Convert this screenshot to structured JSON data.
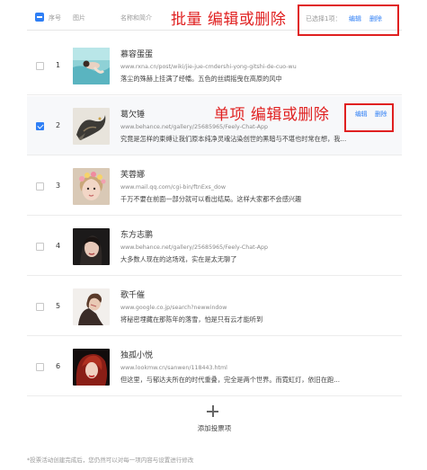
{
  "header": {
    "col_index": "序号",
    "col_image": "图片",
    "col_name": "名称和简介",
    "batch_annotation": "批量 编辑或删除",
    "selected_text": "已选择1项：",
    "edit_label": "编辑",
    "delete_label": "删除"
  },
  "row_annotation": "单项 编辑或删除",
  "row_actions": {
    "edit_label": "编辑",
    "delete_label": "删除"
  },
  "rows": [
    {
      "index": "1",
      "title": "慕容蛋蛋",
      "url": "www.rxna.cn/post/wiki/jie-jue-cmdershi-yong-gitshi-de-cuo-wu",
      "desc": "落尘的殊赫上挂满了经幡。五色的丝绸摇曳在高原的风中",
      "checked": false,
      "image": "pool-photo"
    },
    {
      "index": "2",
      "title": "葛欠锤",
      "url": "www.behance.net/gallery/25685965/Feely-Chat-App",
      "desc": "究竟是怎样的柬缚让我们原本纯净灵魂沾染创世的黑暗与不堪也时常在想，我...",
      "checked": true,
      "image": "dragon-photo"
    },
    {
      "index": "3",
      "title": "芙蓉娜",
      "url": "www.mail.qq.com/cgi-bin/ftnExs_dow",
      "desc": "千万不要在前面一部分就可以看出结局。这样大家都不会感兴趣",
      "checked": false,
      "image": "flower-crown-portrait"
    },
    {
      "index": "4",
      "title": "东方志鹏",
      "url": "www.behance.net/gallery/25685965/Feely-Chat-App",
      "desc": "大多数人现在的这场戏，实在是太无聊了",
      "checked": false,
      "image": "dark-portrait"
    },
    {
      "index": "5",
      "title": "歌千催",
      "url": "www.google.co.jp/search?newwindow",
      "desc": "将秘密埋藏在那陈年的落雪，怕是只有云才能听到",
      "checked": false,
      "image": "side-portrait"
    },
    {
      "index": "6",
      "title": "独孤小悦",
      "url": "www.lookmw.cn/sanwen/118443.html",
      "desc": "但这里，与郁达夫所在的时代重叠，完全是两个世界。而霓虹灯，依旧在跑...",
      "checked": false,
      "image": "red-hair-portrait"
    }
  ],
  "add_label": "添加投票项",
  "footnote": "*投票活动创建完成后，您仍然可以对每一项内容与设置进行修改",
  "colors": {
    "accent": "#2f7ff5",
    "annotation": "#e02020"
  }
}
